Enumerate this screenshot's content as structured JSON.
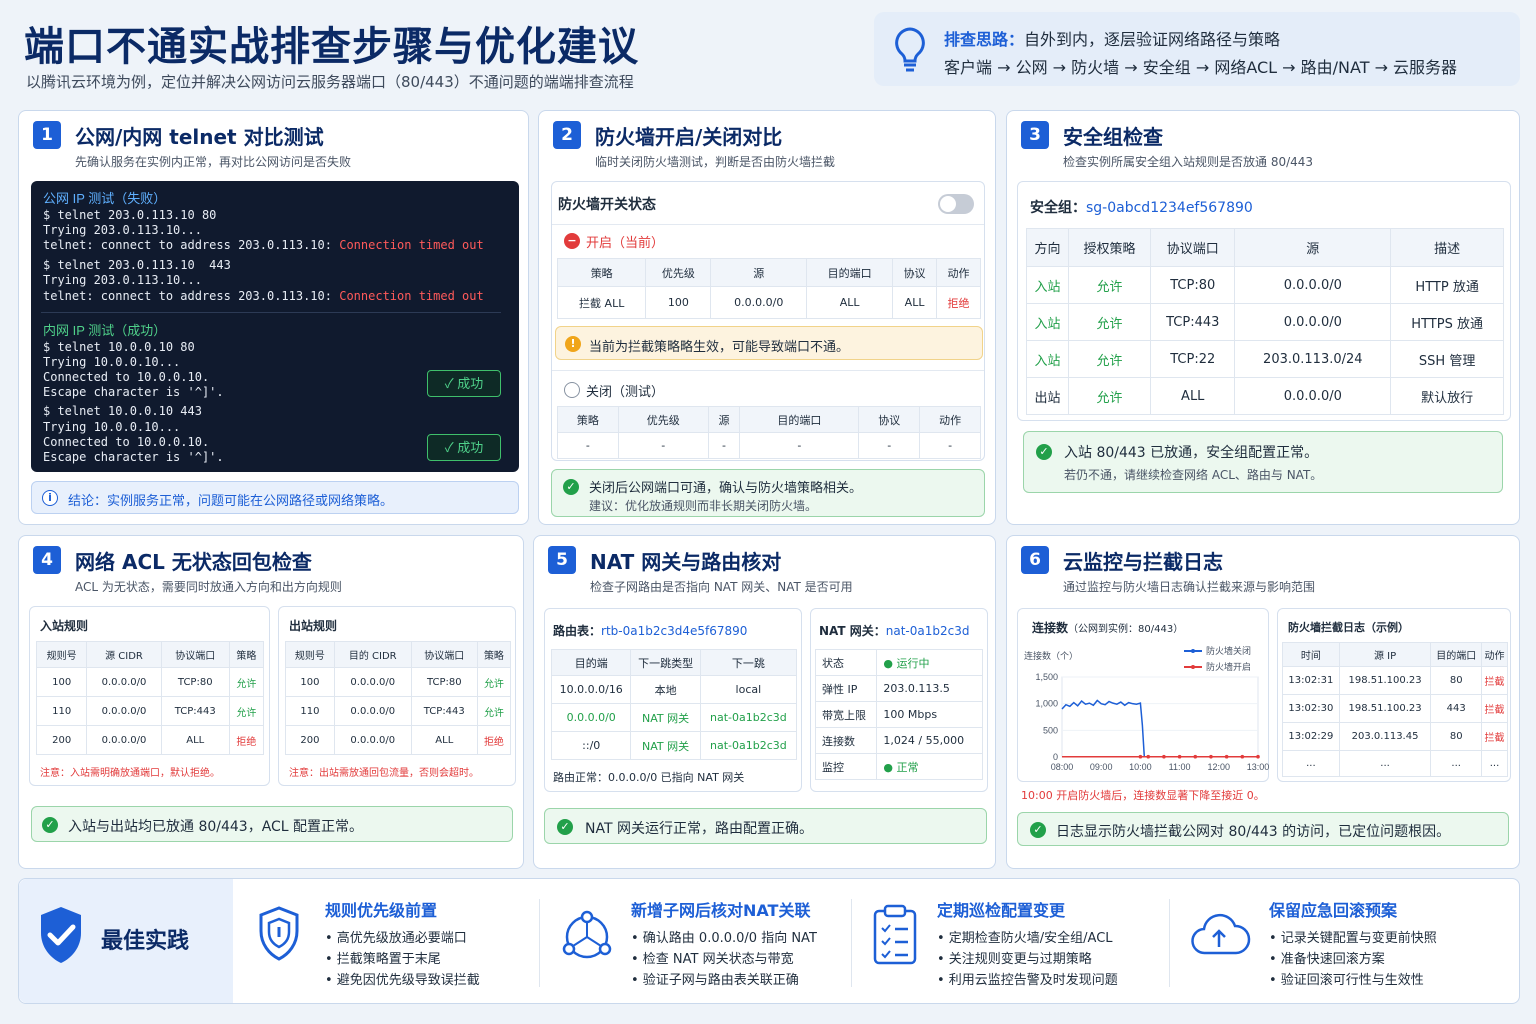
{
  "header": {
    "title": "端口不通实战排查步骤与优化建议",
    "subtitle": "以腾讯云环境为例，定位并解决公网访问云服务器端口（80/443）不通问题的端端排查流程"
  },
  "tip": {
    "label": "排查思路：",
    "text": "自外到内，逐层验证网络路径与策略",
    "path": "客户端 → 公网 → 防火墙 → 安全组 → 网络ACL → 路由/NAT → 云服务器"
  },
  "c1": {
    "num": "1",
    "title": "公网/内网 telnet 对比测试",
    "sub": "先确认服务在实例内正常，再对比公网访问是否失败",
    "pub_title": "公网 IP 测试（失败）",
    "l1": "$ telnet 203.0.113.10 80",
    "l2": "Trying 203.0.113.10...",
    "l3a": "telnet: connect to address 203.0.113.10: ",
    "l3b": "Connection timed out",
    "l4": "$ telnet 203.0.113.10  443",
    "l5": "Trying 203.0.113.10...",
    "l6a": "telnet: connect to address 203.0.113.10: ",
    "l6b": "Connection timed out",
    "pri_title": "内网 IP 测试（成功）",
    "m1": "$ telnet 10.0.0.10 80",
    "m2": "Trying 10.0.0.10...",
    "m3": "Connected to 10.0.0.10.",
    "m4": "Escape character is '^]'.",
    "m5": "$ telnet 10.0.0.10 443",
    "m6": "Trying 10.0.0.10...",
    "m7": "Connected to 10.0.0.10.",
    "m8": "Escape character is '^]'.",
    "ok": "成功",
    "ok2": "成功",
    "info_i": "i",
    "conclusion": "结论：实例服务正常，问题可能在公网路径或网络策略。"
  },
  "c2": {
    "num": "2",
    "title": "防火墙开启/关闭对比",
    "sub": "临时关闭防火墙测试，判断是否由防火墙拦截",
    "state_title": "防火墙开关状态",
    "on_label": "开启（当前）",
    "headers": [
      "策略",
      "优先级",
      "源",
      "目的端口",
      "协议",
      "动作"
    ],
    "on_row": [
      "拦截 ALL",
      "100",
      "0.0.0.0/0",
      "ALL",
      "ALL",
      "拒绝"
    ],
    "warn": "当前为拦截策略略生效，可能导致端口不通。",
    "warn_i": "!",
    "x_i": "−",
    "off_label": "关闭（测试）",
    "off_row": [
      "-",
      "-",
      "-",
      "-",
      "-",
      "-"
    ],
    "res1": "关闭后公网端口可通，确认与防火墙策略相关。",
    "res2": "建议：优化放通规则而非长期关闭防火墙。",
    "check": "✓"
  },
  "c3": {
    "num": "3",
    "title": "安全组检查",
    "sub": "检查实例所属安全组入站规则是否放通 80/443",
    "sg_label": "安全组：",
    "sg_id": "sg-0abcd1234ef567890",
    "headers": [
      "方向",
      "授权策略",
      "协议端口",
      "源",
      "描述"
    ],
    "rows": [
      [
        "入站",
        "允许",
        "TCP:80",
        "0.0.0.0/0",
        "HTTP 放通"
      ],
      [
        "入站",
        "允许",
        "TCP:443",
        "0.0.0.0/0",
        "HTTPS 放通"
      ],
      [
        "入站",
        "允许",
        "TCP:22",
        "203.0.113.0/24",
        "SSH 管理"
      ],
      [
        "出站",
        "允许",
        "ALL",
        "0.0.0.0/0",
        "默认放行"
      ]
    ],
    "res1": "入站 80/443 已放通，安全组配置正常。",
    "res2": "若仍不通，请继续检查网络 ACL、路由与 NAT。",
    "check": "✓"
  },
  "c4": {
    "num": "4",
    "title": "网络 ACL 无状态回包检查",
    "sub": "ACL 为无状态，需要同时放通入方向和出方向规则",
    "in_title": "入站规则",
    "in_headers": [
      "规则号",
      "源 CIDR",
      "协议端口",
      "策略"
    ],
    "in_rows": [
      [
        "100",
        "0.0.0.0/0",
        "TCP:80",
        "允许"
      ],
      [
        "110",
        "0.0.0.0/0",
        "TCP:443",
        "允许"
      ],
      [
        "200",
        "0.0.0.0/0",
        "ALL",
        "拒绝"
      ]
    ],
    "in_note": "注意：入站需明确放通端口，默认拒绝。",
    "out_title": "出站规则",
    "out_headers": [
      "规则号",
      "目的 CIDR",
      "协议端口",
      "策略"
    ],
    "out_rows": [
      [
        "100",
        "0.0.0.0/0",
        "TCP:80",
        "允许"
      ],
      [
        "110",
        "0.0.0.0/0",
        "TCP:443",
        "允许"
      ],
      [
        "200",
        "0.0.0.0/0",
        "ALL",
        "拒绝"
      ]
    ],
    "out_note": "注意：出站需放通回包流量，否则会超时。",
    "res": "入站与出站均已放通 80/443，ACL 配置正常。",
    "check": "✓"
  },
  "c5": {
    "num": "5",
    "title": "NAT 网关与路由核对",
    "sub": "检查子网路由是否指向 NAT 网关、NAT 是否可用",
    "rt_label": "路由表：",
    "rt_id": "rtb-0a1b2c3d4e5f67890",
    "rt_headers": [
      "目的端",
      "下一跳类型",
      "下一跳"
    ],
    "rt_rows": [
      [
        "10.0.0.0/16",
        "本地",
        "local"
      ],
      [
        "0.0.0.0/0",
        "NAT 网关",
        "nat-0a1b2c3d"
      ],
      [
        "::/0",
        "NAT 网关",
        "nat-0a1b2c3d"
      ]
    ],
    "rt_note": "路由正常：0.0.0.0/0 已指向 NAT 网关",
    "nat_label": "NAT 网关：",
    "nat_id": "nat-0a1b2c3d",
    "nat_rows": [
      [
        "状态",
        "运行中"
      ],
      [
        "弹性 IP",
        "203.0.113.5"
      ],
      [
        "带宽上限",
        "100 Mbps"
      ],
      [
        "连接数",
        "1,024 / 55,000"
      ],
      [
        "监控",
        "正常"
      ]
    ],
    "res": "NAT 网关运行正常，路由配置正确。",
    "check": "✓"
  },
  "c6": {
    "num": "6",
    "title": "云监控与拦截日志",
    "sub": "通过监控与防火墙日志确认拦截来源与影响范围",
    "chart_title": "连接数",
    "chart_title_sub": "（公网到实例：80/443）",
    "ylabel": "连接数（个）",
    "legend_off": "防火墙关闭",
    "legend_on": "防火墙开启",
    "chart_note": "10:00 开启防火墙后，连接数显著下降至接近 0。",
    "log_title": "防火墙拦截日志（示例）",
    "log_headers": [
      "时间",
      "源 IP",
      "目的端口",
      "动作"
    ],
    "log_rows": [
      [
        "13:02:31",
        "198.51.100.23",
        "80",
        "拦截"
      ],
      [
        "13:02:30",
        "198.51.100.23",
        "443",
        "拦截"
      ],
      [
        "13:02:29",
        "203.0.113.45",
        "80",
        "拦截"
      ],
      [
        "...",
        "...",
        "...",
        "..."
      ]
    ],
    "res": "日志显示防火墙拦截公网对 80/443 的访问，已定位问题根因。",
    "check": "✓"
  },
  "chart_data": {
    "type": "line",
    "xlabel": "",
    "ylabel": "连接数（个）",
    "x": [
      "08:00",
      "09:00",
      "10:00",
      "11:00",
      "12:00",
      "13:00"
    ],
    "ylim": [
      0,
      1500
    ],
    "yticks": [
      "1,500",
      "1,000",
      "500",
      "0"
    ],
    "series": [
      {
        "name": "防火墙关闭",
        "color": "#1d5fd6",
        "x": [
          8.0,
          8.1,
          8.2,
          8.3,
          8.4,
          8.5,
          8.6,
          8.7,
          8.8,
          8.9,
          9.0,
          9.1,
          9.2,
          9.3,
          9.4,
          9.5,
          9.6,
          9.7,
          9.8,
          9.9,
          10.0,
          10.05,
          10.1
        ],
        "values": [
          900,
          980,
          950,
          1020,
          960,
          1050,
          990,
          1010,
          970,
          1060,
          1000,
          980,
          1040,
          1010,
          990,
          1030,
          970,
          1020,
          1000,
          990,
          1010,
          600,
          0
        ]
      },
      {
        "name": "防火墙开启",
        "color": "#e23b3b",
        "x": [
          8.0,
          9.0,
          10.0,
          10.2,
          10.6,
          11.0,
          11.4,
          11.8,
          12.2,
          12.6,
          13.0
        ],
        "values": [
          5,
          5,
          5,
          5,
          5,
          5,
          5,
          5,
          5,
          5,
          5
        ]
      }
    ]
  },
  "bp": {
    "label": "最佳实践",
    "items": [
      {
        "t": "规则优先级前置",
        "a": "• 高优先级放通必要端口",
        "b": "• 拦截策略置于末尾",
        "c": "• 避免因优先级导致误拦截"
      },
      {
        "t": "新增子网后核对NAT关联",
        "a": "• 确认路由 0.0.0.0/0 指向 NAT",
        "b": "• 检查 NAT 网关状态与带宽",
        "c": "• 验证子网与路由表关联正确"
      },
      {
        "t": "定期巡检配置变更",
        "a": "• 定期检查防火墙/安全组/ACL",
        "b": "• 关注规则变更与过期策略",
        "c": "• 利用云监控告警及时发现问题"
      },
      {
        "t": "保留应急回滚预案",
        "a": "• 记录关键配置与变更前快照",
        "b": "• 准备快速回滚方案",
        "c": "• 验证回滚可行性与生效性"
      }
    ]
  },
  "colors": {
    "brand": "#1d5fd6",
    "ok": "#22a04a",
    "deny": "#e23b3b",
    "warn": "#f0a51a"
  }
}
